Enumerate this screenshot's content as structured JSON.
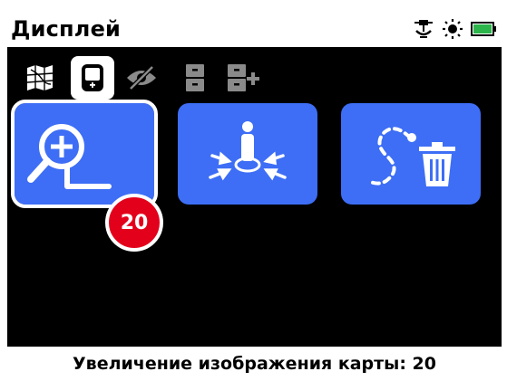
{
  "header": {
    "title": "Дисплей",
    "status_icons": [
      "gps-icon",
      "sun-icon",
      "battery-icon"
    ],
    "battery_level": 1.0
  },
  "tabs": [
    {
      "icon": "map-grid-icon",
      "selected": false
    },
    {
      "icon": "device-display-icon",
      "selected": true
    },
    {
      "icon": "visibility-off-icon",
      "selected": false
    },
    {
      "icon": "storage-icon",
      "selected": false
    },
    {
      "icon": "storage-add-icon",
      "selected": false
    }
  ],
  "tiles": [
    {
      "icon": "map-zoom-icon",
      "selected": true,
      "badge": "20"
    },
    {
      "icon": "center-position-icon",
      "selected": false
    },
    {
      "icon": "clear-track-icon",
      "selected": false
    }
  ],
  "footer": {
    "caption": "Увеличение изображения карты: 20"
  },
  "colors": {
    "accent": "#3d6ef5",
    "badge": "#e3001b",
    "battery": "#2bb54a",
    "background": "#000000"
  }
}
